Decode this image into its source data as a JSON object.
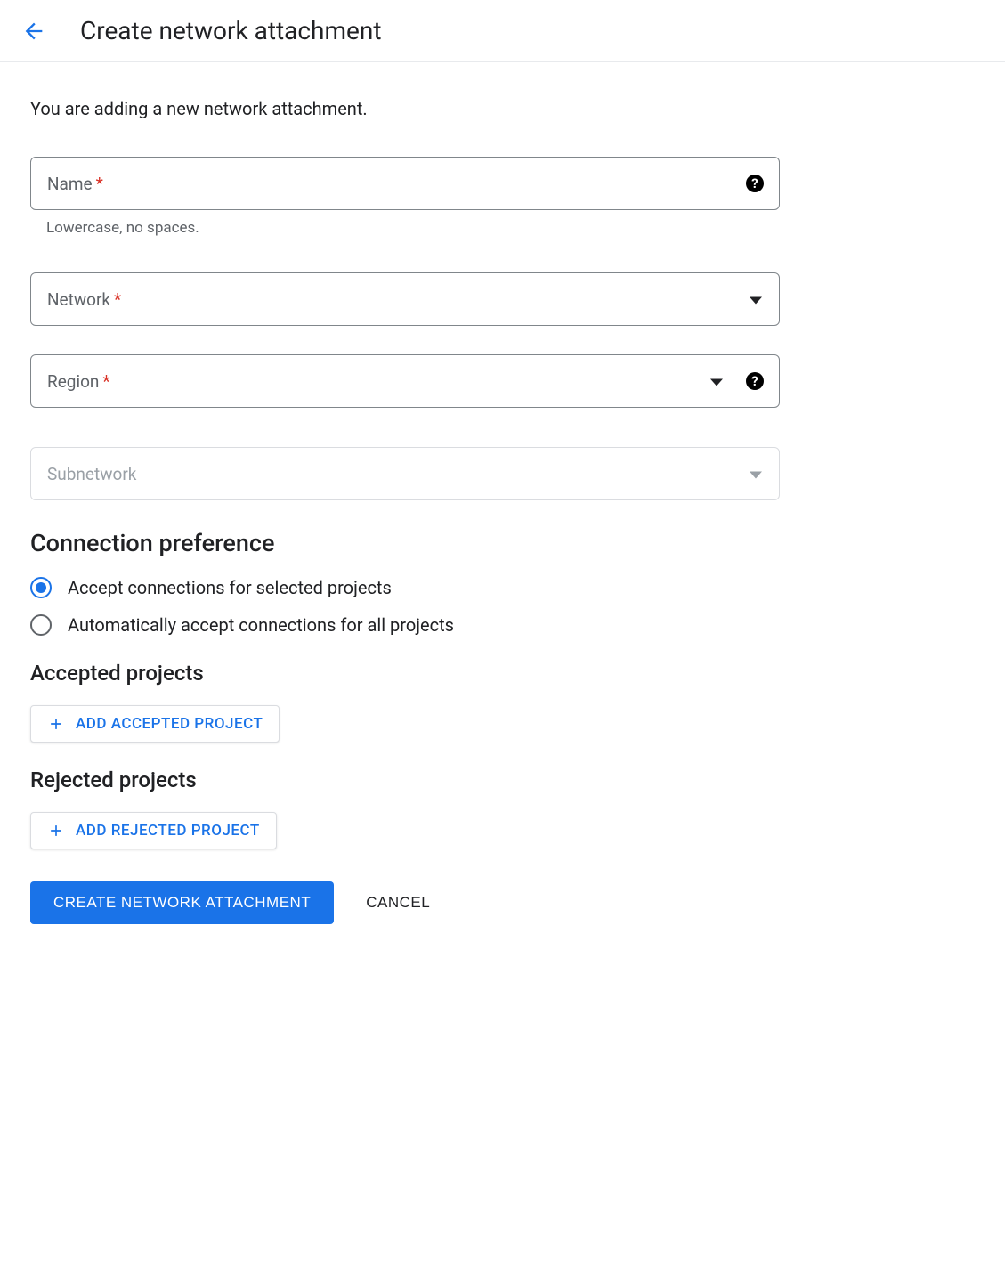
{
  "header": {
    "title": "Create network attachment"
  },
  "intro": "You are adding a new network attachment.",
  "fields": {
    "name": {
      "label": "Name",
      "hint": "Lowercase, no spaces."
    },
    "network": {
      "label": "Network"
    },
    "region": {
      "label": "Region"
    },
    "subnetwork": {
      "label": "Subnetwork"
    }
  },
  "sections": {
    "connection_pref": "Connection preference",
    "accepted": "Accepted projects",
    "rejected": "Rejected projects"
  },
  "radios": {
    "selected": "Accept connections for selected projects",
    "all": "Automatically accept connections for all projects"
  },
  "buttons": {
    "add_accepted": "ADD ACCEPTED PROJECT",
    "add_rejected": "ADD REJECTED PROJECT",
    "create": "CREATE NETWORK ATTACHMENT",
    "cancel": "CANCEL"
  }
}
